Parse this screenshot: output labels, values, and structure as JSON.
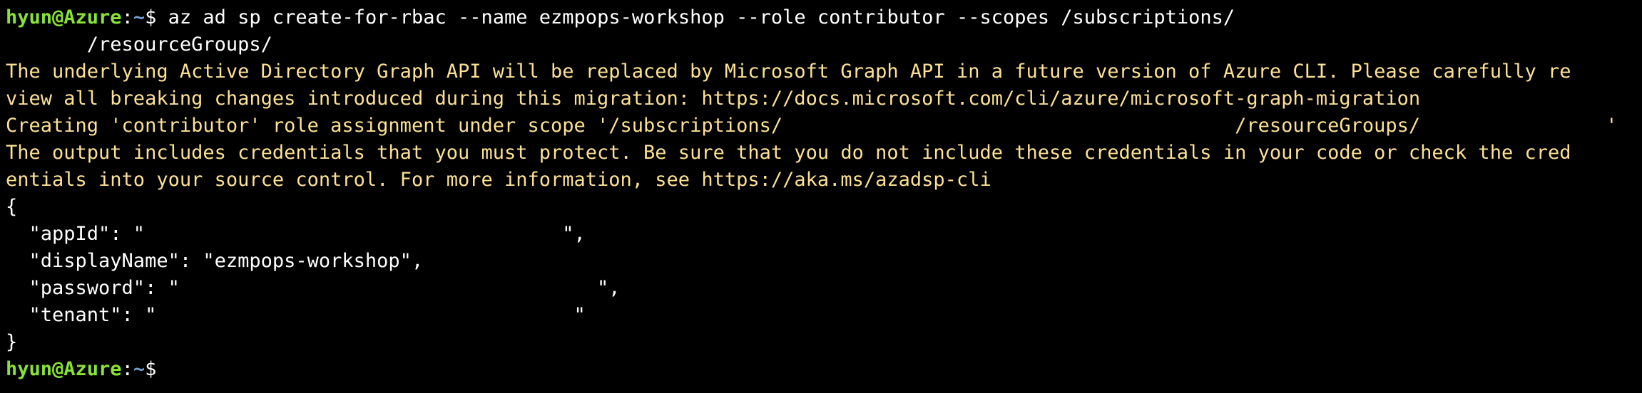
{
  "prompt": {
    "user_host": "hyun@Azure",
    "separator": ":",
    "path": "~",
    "symbol": "$"
  },
  "command": {
    "line1": " az ad sp create-for-rbac --name ezmpops-workshop --role contributor --scopes /subscriptions/",
    "line2": "       /resourceGroups/"
  },
  "warnings": [
    "The underlying Active Directory Graph API will be replaced by Microsoft Graph API in a future version of Azure CLI. Please carefully re",
    "view all breaking changes introduced during this migration: https://docs.microsoft.com/cli/azure/microsoft-graph-migration",
    "Creating 'contributor' role assignment under scope '/subscriptions/                                       /resourceGroups/                '",
    "The output includes credentials that you must protect. Be sure that you do not include these credentials in your code or check the cred",
    "entials into your source control. For more information, see https://aka.ms/azadsp-cli"
  ],
  "json_output": [
    "{",
    "  \"appId\": \"                                    \",",
    "  \"displayName\": \"ezmpops-workshop\",",
    "  \"password\": \"                                    \",",
    "  \"tenant\": \"                                    \"",
    "}"
  ]
}
